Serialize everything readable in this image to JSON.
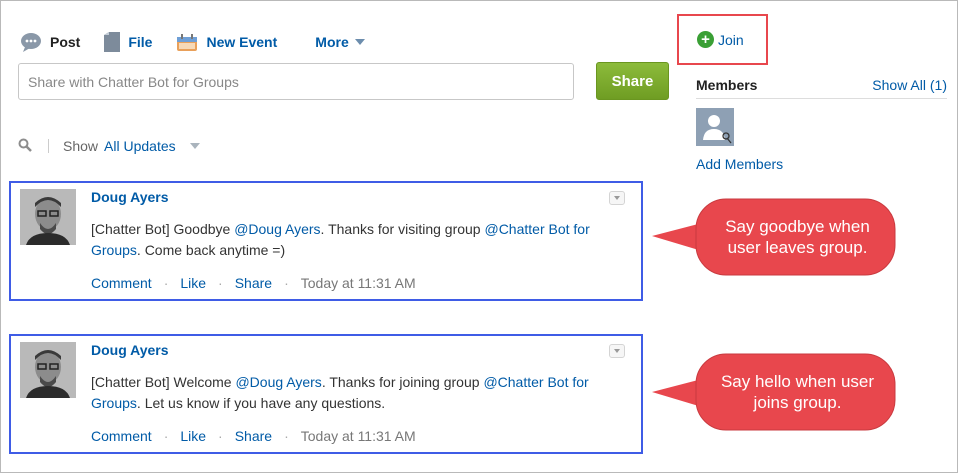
{
  "publisher": {
    "tabs": [
      {
        "label": "Post",
        "icon": "speech-bubble-icon"
      },
      {
        "label": "File",
        "icon": "file-icon"
      },
      {
        "label": "New Event",
        "icon": "calendar-event-icon"
      },
      {
        "label": "More",
        "icon": "chevron-down-icon"
      }
    ],
    "placeholder": "Share with Chatter Bot for Groups",
    "share_label": "Share",
    "share_color": "#7bab2e"
  },
  "filter": {
    "show_label": "Show",
    "value": "All Updates",
    "icon": "search-icon"
  },
  "feed": [
    {
      "author": "Doug Ayers",
      "body_parts": [
        {
          "text": "[Chatter Bot] Goodbye "
        },
        {
          "text": "@Doug Ayers",
          "mention": true
        },
        {
          "text": ". Thanks for visiting group "
        },
        {
          "text": "@Chatter Bot for Groups",
          "mention": true
        },
        {
          "text": ". Come back anytime =)"
        }
      ],
      "actions": [
        "Comment",
        "Like",
        "Share"
      ],
      "timestamp": "Today at 11:31 AM"
    },
    {
      "author": "Doug Ayers",
      "body_parts": [
        {
          "text": "[Chatter Bot] Welcome "
        },
        {
          "text": "@Doug Ayers",
          "mention": true
        },
        {
          "text": ". Thanks for joining group "
        },
        {
          "text": "@Chatter Bot for Groups",
          "mention": true
        },
        {
          "text": ". Let us know if you have any questions."
        }
      ],
      "actions": [
        "Comment",
        "Like",
        "Share"
      ],
      "timestamp": "Today at 11:31 AM"
    }
  ],
  "sidebar": {
    "join_label": "Join",
    "members_title": "Members",
    "show_all": "Show All (1)",
    "add_members": "Add Members"
  },
  "callouts": [
    {
      "text": "Say goodbye when user leaves group."
    },
    {
      "text": "Say hello when user joins group."
    }
  ],
  "colors": {
    "link": "#015ba7",
    "highlight_post_border": "#3f5ce6",
    "highlight_join_border": "#e8474d",
    "callout_fill": "#e8474d"
  }
}
